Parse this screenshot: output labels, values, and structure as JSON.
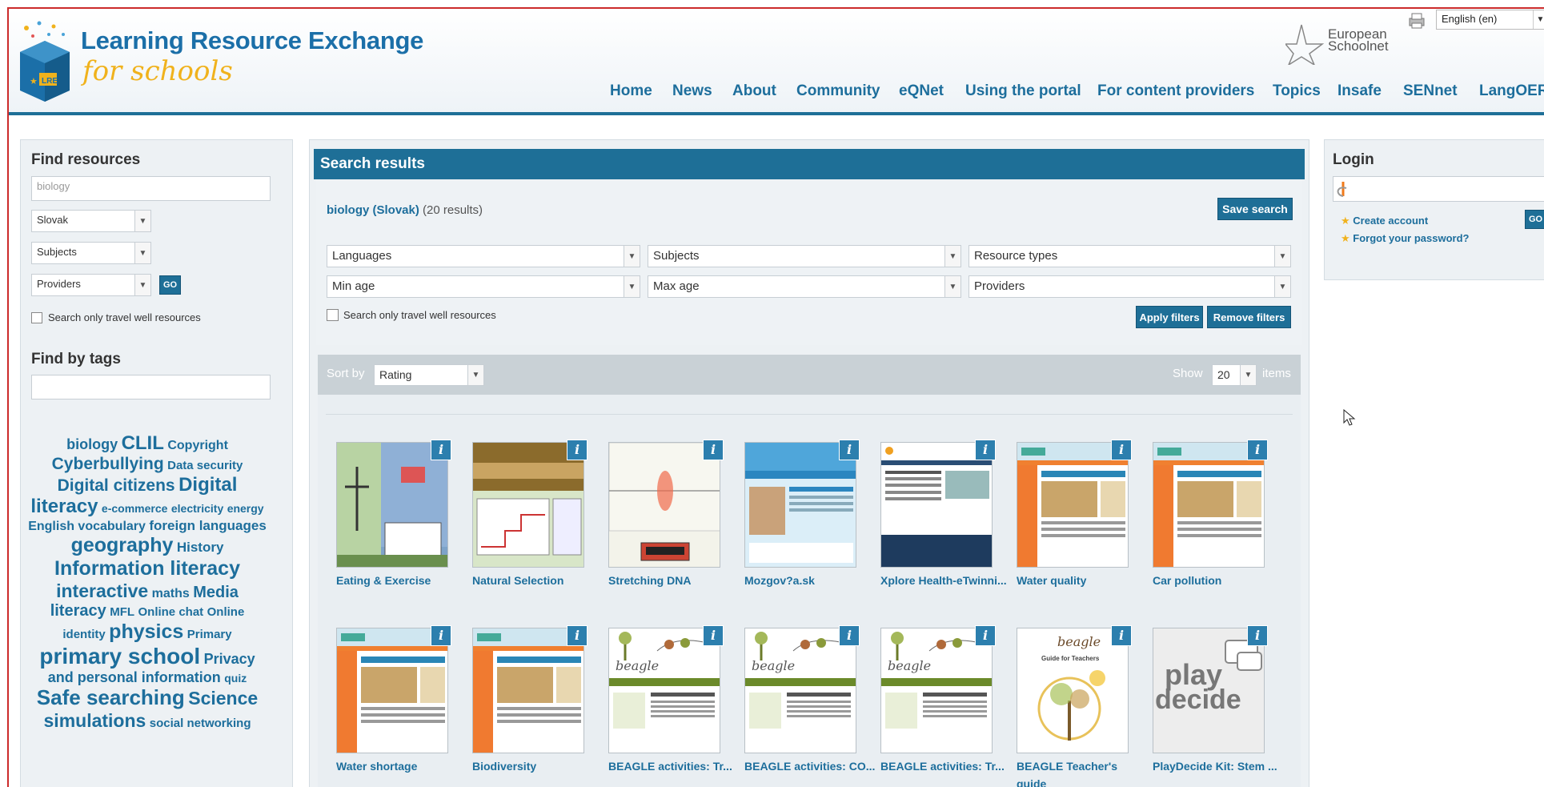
{
  "header": {
    "title": "Learning Resource Exchange",
    "subtitle": "for schools",
    "logo_badge": "LRE",
    "partner": "European Schoolnet",
    "language": "English (en)"
  },
  "nav": [
    "Home",
    "News",
    "About",
    "Community",
    "eQNet",
    "Using the portal",
    "For content providers",
    "Topics",
    "Insafe",
    "SENnet",
    "LangOER"
  ],
  "find": {
    "title": "Find resources",
    "query": "biology",
    "language": "Slovak",
    "subjects": "Subjects",
    "providers": "Providers",
    "go": "GO",
    "travel_well": "Search only travel well resources"
  },
  "tags_section": {
    "title": "Find by tags",
    "tags": [
      {
        "text": "biology",
        "size": 18
      },
      {
        "text": "CLIL",
        "size": 24
      },
      {
        "text": "Copyright",
        "size": 16
      },
      {
        "text": "Cyberbullying",
        "size": 21
      },
      {
        "text": "Data security",
        "size": 15
      },
      {
        "text": "Digital citizens",
        "size": 21
      },
      {
        "text": "Digital literacy",
        "size": 24
      },
      {
        "text": "e-commerce",
        "size": 14
      },
      {
        "text": "electricity",
        "size": 14
      },
      {
        "text": "energy",
        "size": 14
      },
      {
        "text": "English vocabulary",
        "size": 16
      },
      {
        "text": "foreign languages",
        "size": 17
      },
      {
        "text": "geography",
        "size": 25
      },
      {
        "text": "History",
        "size": 17
      },
      {
        "text": "Information literacy",
        "size": 25
      },
      {
        "text": "interactive",
        "size": 23
      },
      {
        "text": "maths",
        "size": 16
      },
      {
        "text": "Media literacy",
        "size": 20
      },
      {
        "text": "MFL",
        "size": 15
      },
      {
        "text": "Online chat",
        "size": 15
      },
      {
        "text": "Online identity",
        "size": 15
      },
      {
        "text": "physics",
        "size": 25
      },
      {
        "text": "Primary",
        "size": 15
      },
      {
        "text": "primary school",
        "size": 28
      },
      {
        "text": "Privacy and personal information",
        "size": 18
      },
      {
        "text": "quiz",
        "size": 14
      },
      {
        "text": "Safe searching",
        "size": 26
      },
      {
        "text": "Science",
        "size": 23
      },
      {
        "text": "simulations",
        "size": 23
      },
      {
        "text": "social networking",
        "size": 15
      }
    ]
  },
  "results": {
    "title": "Search results",
    "query_text": "biology (Slovak)",
    "count_text": "(20 results)",
    "save_search": "Save search",
    "filters": {
      "languages": "Languages",
      "subjects": "Subjects",
      "resource_types": "Resource types",
      "min_age": "Min age",
      "max_age": "Max age",
      "providers": "Providers"
    },
    "travel_well": "Search only travel well resources",
    "apply": "Apply filters",
    "remove": "Remove filters",
    "sort_label": "Sort by",
    "sort_value": "Rating",
    "show_label": "Show",
    "show_value": "20",
    "items_label": "items",
    "info_glyph": "i",
    "cards": [
      {
        "title": "Eating & Exercise",
        "thumb": "sim-figure"
      },
      {
        "title": "Natural Selection",
        "thumb": "sim-desert"
      },
      {
        "title": "Stretching DNA",
        "thumb": "sim-dna"
      },
      {
        "title": "Mozgov?a.sk",
        "thumb": "web-blue"
      },
      {
        "title": "Xplore Health-eTwinni...",
        "thumb": "web-text"
      },
      {
        "title": "Water quality",
        "thumb": "web-orange"
      },
      {
        "title": "Car pollution",
        "thumb": "web-orange"
      },
      {
        "title": "Water shortage",
        "thumb": "web-orange"
      },
      {
        "title": "Biodiversity",
        "thumb": "web-orange"
      },
      {
        "title": "BEAGLE activities: Tr...",
        "thumb": "beagle"
      },
      {
        "title": "BEAGLE activities: CO...",
        "thumb": "beagle"
      },
      {
        "title": "BEAGLE activities: Tr...",
        "thumb": "beagle"
      },
      {
        "title": "BEAGLE Teacher's guide",
        "thumb": "beagle-guide"
      },
      {
        "title": "PlayDecide Kit: Stem ...",
        "thumb": "playdecide"
      }
    ],
    "thumb_text": {
      "beagle_word": "beagle",
      "guide_line1": "beagle",
      "guide_line2": "Guide for Teachers",
      "play1": "play",
      "play2": "decide"
    }
  },
  "login": {
    "title": "Login",
    "go": "GO",
    "create_account": "Create account",
    "forgot_password": "Forgot your password?"
  },
  "colors": {
    "brand_blue": "#1e6f97",
    "link_blue": "#1d6e9c",
    "accent_yellow": "#f0b21c",
    "frame_red": "#cc2b2b"
  }
}
